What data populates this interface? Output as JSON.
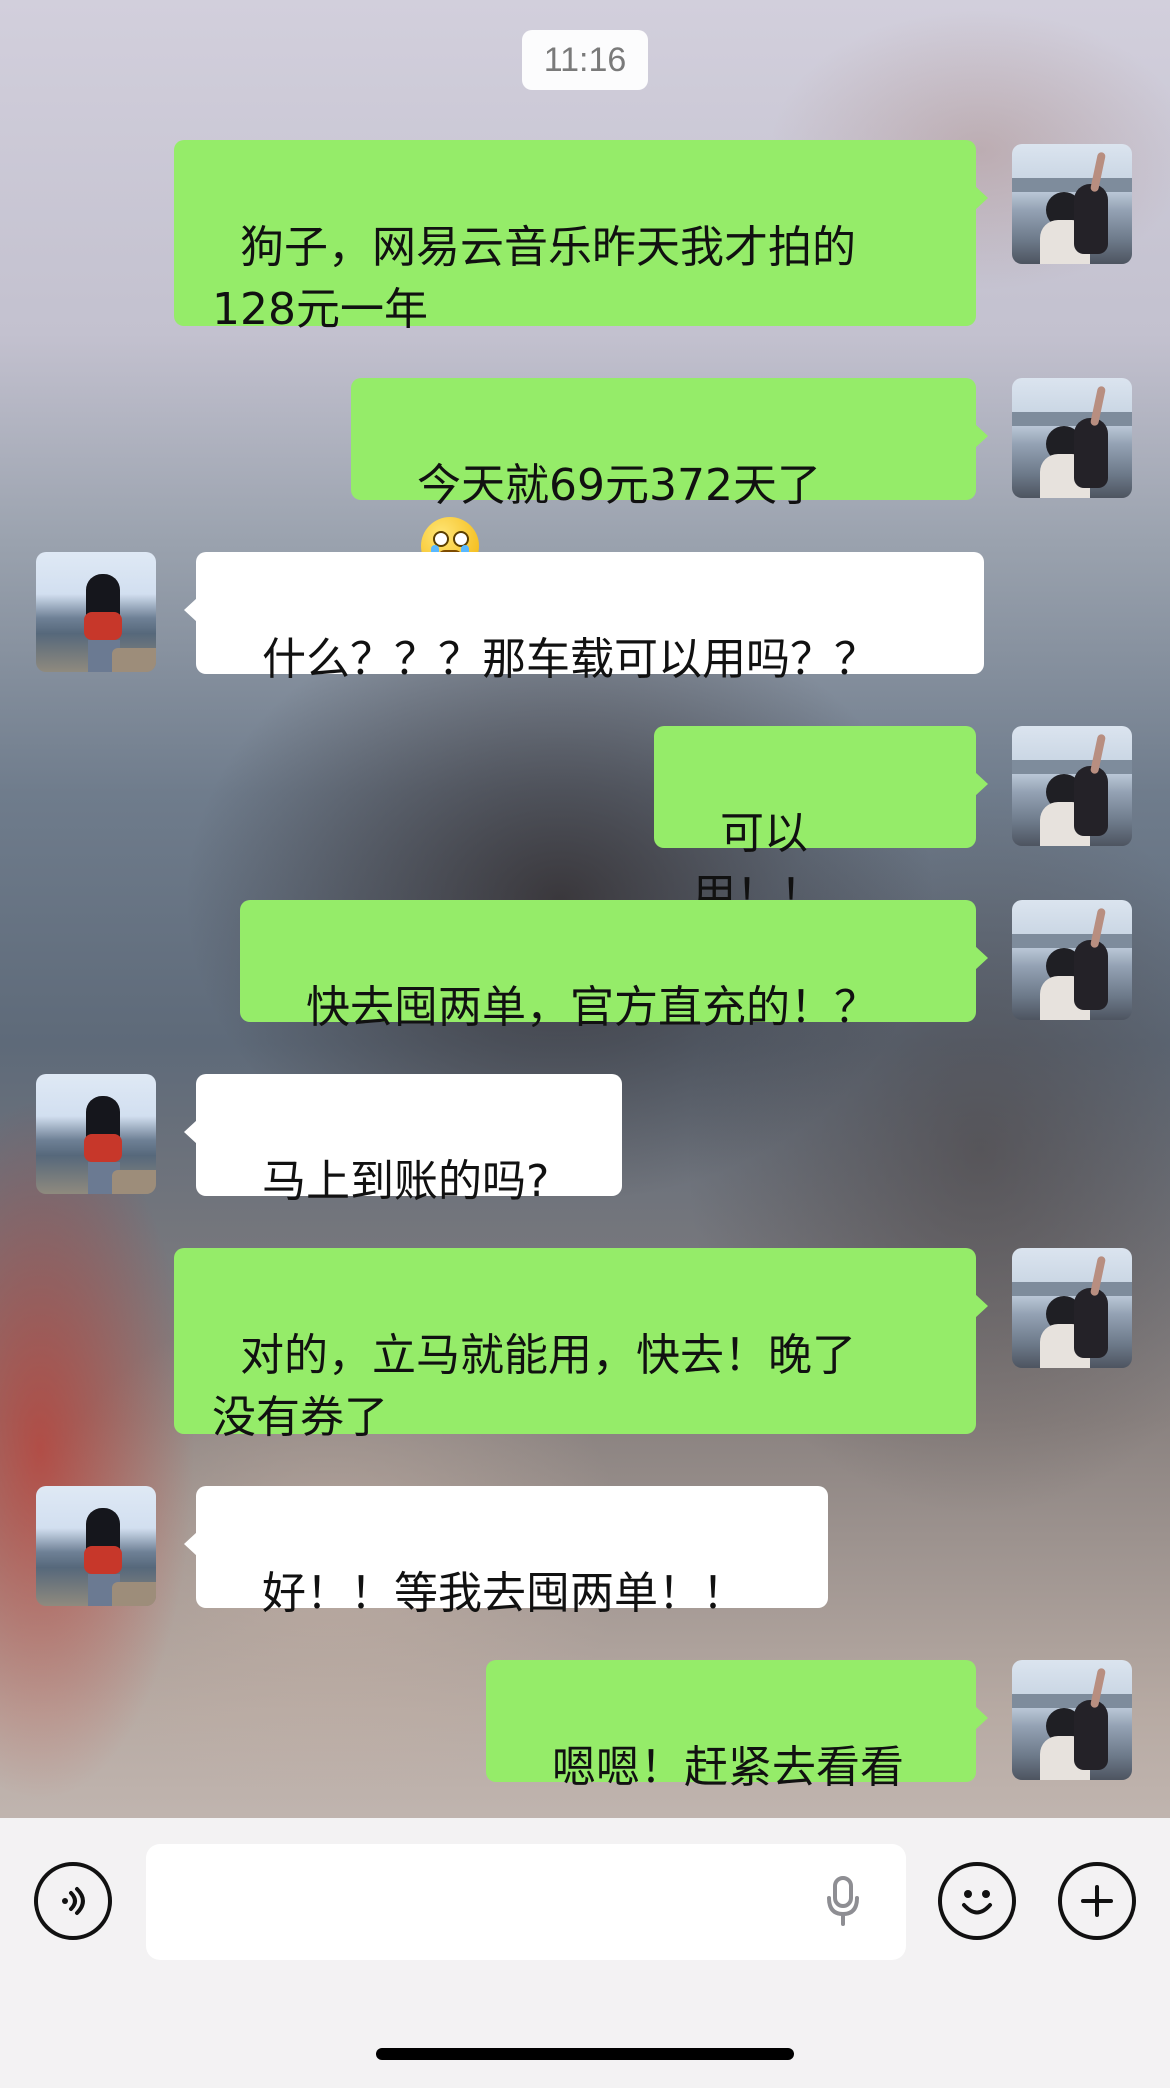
{
  "status": {
    "time": "11:16"
  },
  "messages": [
    {
      "side": "sent",
      "text": "狗子，网易云音乐昨天我才拍的\n128元一年"
    },
    {
      "side": "sent",
      "text": "今天就69元372天了",
      "emoji": "crying-face-emoji"
    },
    {
      "side": "received",
      "text": "什么？？？那车载可以用吗？？"
    },
    {
      "side": "sent",
      "text": "可以用！！"
    },
    {
      "side": "sent",
      "text": "快去囤两单，官方直充的！？"
    },
    {
      "side": "received",
      "text": "马上到账的吗?"
    },
    {
      "side": "sent",
      "text": "对的，立马就能用，快去！晚了\n没有券了"
    },
    {
      "side": "received",
      "text": "好！！等我去囤两单！！"
    },
    {
      "side": "sent",
      "text": "嗯嗯！赶紧去看看"
    }
  ],
  "input_bar": {
    "voice_icon": "voice-icon",
    "mic_icon": "mic-icon",
    "emoji_icon": "emoji-icon",
    "plus_icon": "plus-icon"
  },
  "theme": {
    "sent_bubble_color": "#95ec69",
    "received_bubble_color": "#ffffff"
  }
}
